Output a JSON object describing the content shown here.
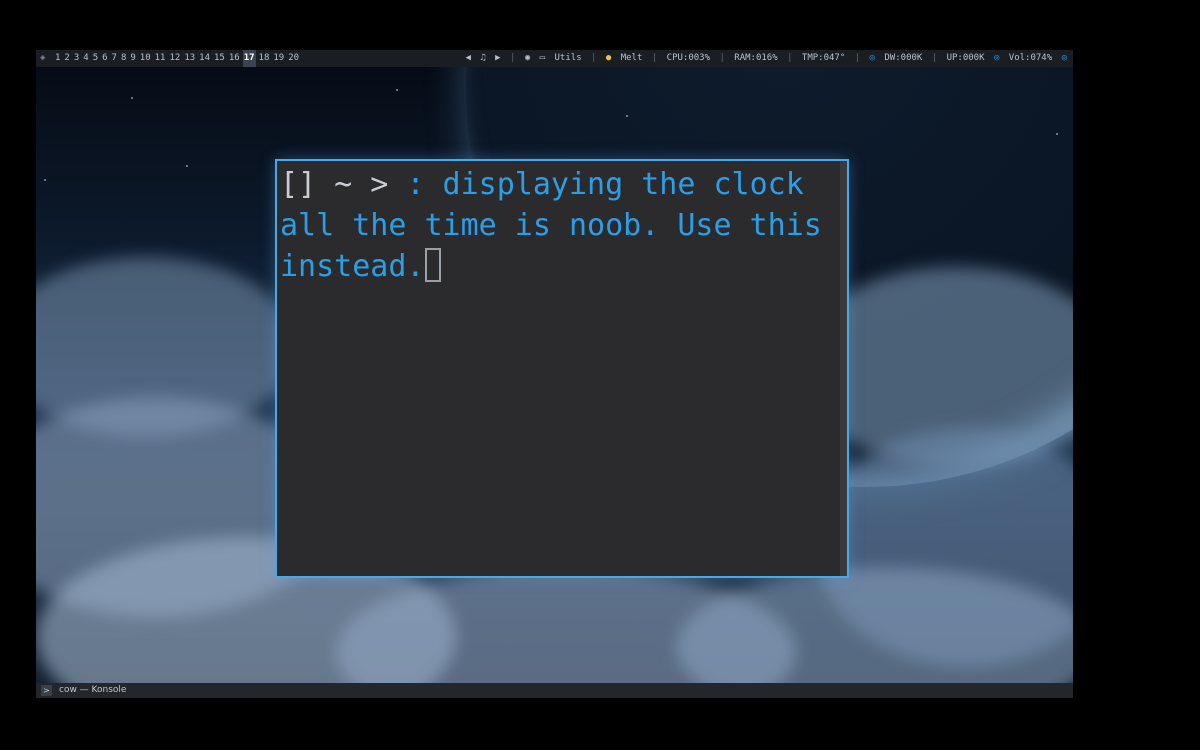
{
  "topbar": {
    "workspaces": [
      "1",
      "2",
      "3",
      "4",
      "5",
      "6",
      "7",
      "8",
      "9",
      "10",
      "11",
      "12",
      "13",
      "14",
      "15",
      "16",
      "17",
      "18",
      "19",
      "20"
    ],
    "active_workspace": "17",
    "media_prev": "◀",
    "media_note": "♫",
    "media_next": "▶",
    "app_utils": "Utils",
    "app_melt": "Melt",
    "cpu": "CPU:003%",
    "ram": "RAM:016%",
    "tmp": "TMP:047°",
    "dw": "DW:000K",
    "up": "UP:000K",
    "vol": "Vol:074%"
  },
  "terminal": {
    "prompt": "[] ~ > ",
    "colon": ":",
    "text": " displaying the clock all the time is noob. Use this instead."
  },
  "taskbar": {
    "window_title": "cow — Konsole"
  },
  "colors": {
    "accent": "#2b9ee8",
    "terminal_bg": "#2b2b2d",
    "border": "#49a8e6"
  }
}
